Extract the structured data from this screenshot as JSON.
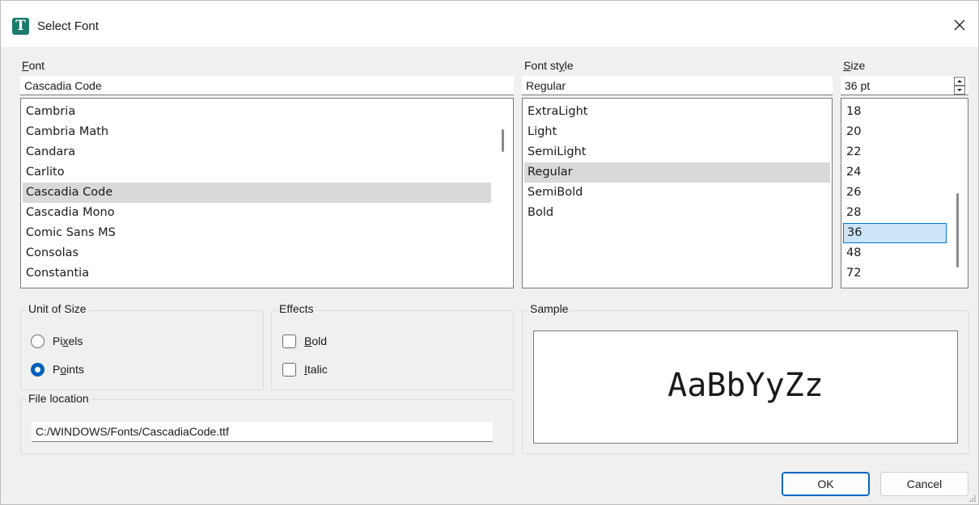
{
  "window": {
    "icon": "T",
    "title": "Select Font",
    "close_icon": "close-icon"
  },
  "font": {
    "label": "Font",
    "underline_char": "F",
    "value": "Cascadia Code",
    "items": [
      "Cambria",
      "Cambria Math",
      "Candara",
      "Carlito",
      "Cascadia Code",
      "Cascadia Mono",
      "Comic Sans MS",
      "Consolas",
      "Constantia"
    ],
    "selected": "Cascadia Code"
  },
  "style": {
    "label": "Font style",
    "value": "Regular",
    "items": [
      "ExtraLight",
      "Light",
      "SemiLight",
      "Regular",
      "SemiBold",
      "Bold"
    ],
    "selected": "Regular"
  },
  "size": {
    "label": "Size",
    "value": "36 pt",
    "items": [
      "18",
      "20",
      "22",
      "24",
      "26",
      "28",
      "36",
      "48",
      "72"
    ],
    "selected": "36"
  },
  "unit_of_size": {
    "title": "Unit of Size",
    "options": [
      {
        "label": "Pixels",
        "checked": false
      },
      {
        "label": "Points",
        "checked": true
      }
    ]
  },
  "effects": {
    "title": "Effects",
    "options": [
      {
        "label": "Bold",
        "checked": false
      },
      {
        "label": "Italic",
        "checked": false
      }
    ]
  },
  "file_location": {
    "title": "File location",
    "value": "C:/WINDOWS/Fonts/CascadiaCode.ttf"
  },
  "sample": {
    "title": "Sample",
    "text": "AaBbYyZz"
  },
  "buttons": {
    "ok": "OK",
    "cancel": "Cancel"
  },
  "colors": {
    "accent": "#005fb8",
    "selection_gray": "#d9d9d9",
    "selection_blue": "#cce4f7",
    "window_bg": "#f0f0f0"
  }
}
